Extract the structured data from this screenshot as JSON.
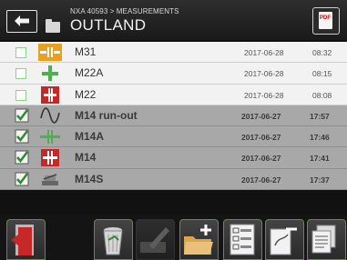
{
  "header": {
    "breadcrumb": "NXA 40593 > MEASUREMENTS",
    "title": "OUTLAND",
    "back_icon": "back-arrow-icon",
    "folder_icon": "folder-icon",
    "pdf_label": "PDF"
  },
  "colors": {
    "header_bg": "#1f1f1f",
    "row_unselected": "#f2f2f2",
    "row_selected": "#a8a8a8",
    "check_green": "#2e8b2e",
    "accent_orange": "#e8a020",
    "accent_red": "#c62828",
    "toolbar_border": "#5a8f4a"
  },
  "measurements": [
    {
      "name": "M31",
      "date": "2017-06-28",
      "time": "08:32",
      "selected": false,
      "icon": "coupling-orange-icon"
    },
    {
      "name": "M22A",
      "date": "2017-06-28",
      "time": "08:15",
      "selected": false,
      "icon": "shaft-green-icon"
    },
    {
      "name": "M22",
      "date": "2017-06-28",
      "time": "08:08",
      "selected": false,
      "icon": "shaft-red-icon"
    },
    {
      "name": "M14 run-out",
      "date": "2017-06-27",
      "time": "17:57",
      "selected": true,
      "icon": "wave-icon"
    },
    {
      "name": "M14A",
      "date": "2017-06-27",
      "time": "17:46",
      "selected": true,
      "icon": "shaft-green-icon"
    },
    {
      "name": "M14",
      "date": "2017-06-27",
      "time": "17:41",
      "selected": true,
      "icon": "shaft-red-icon"
    },
    {
      "name": "M14S",
      "date": "2017-06-27",
      "time": "17:37",
      "selected": true,
      "icon": "machine-icon"
    }
  ],
  "toolbar": [
    {
      "name": "exit-button",
      "icon": "exit-door-icon"
    },
    {
      "name": "delete-button",
      "icon": "trash-icon"
    },
    {
      "name": "edit-button",
      "icon": "edit-icon"
    },
    {
      "name": "new-folder-button",
      "icon": "folder-add-icon"
    },
    {
      "name": "list-view-button",
      "icon": "list-icon"
    },
    {
      "name": "remove-from-report-button",
      "icon": "document-minus-icon"
    },
    {
      "name": "report-button",
      "icon": "documents-icon"
    }
  ]
}
